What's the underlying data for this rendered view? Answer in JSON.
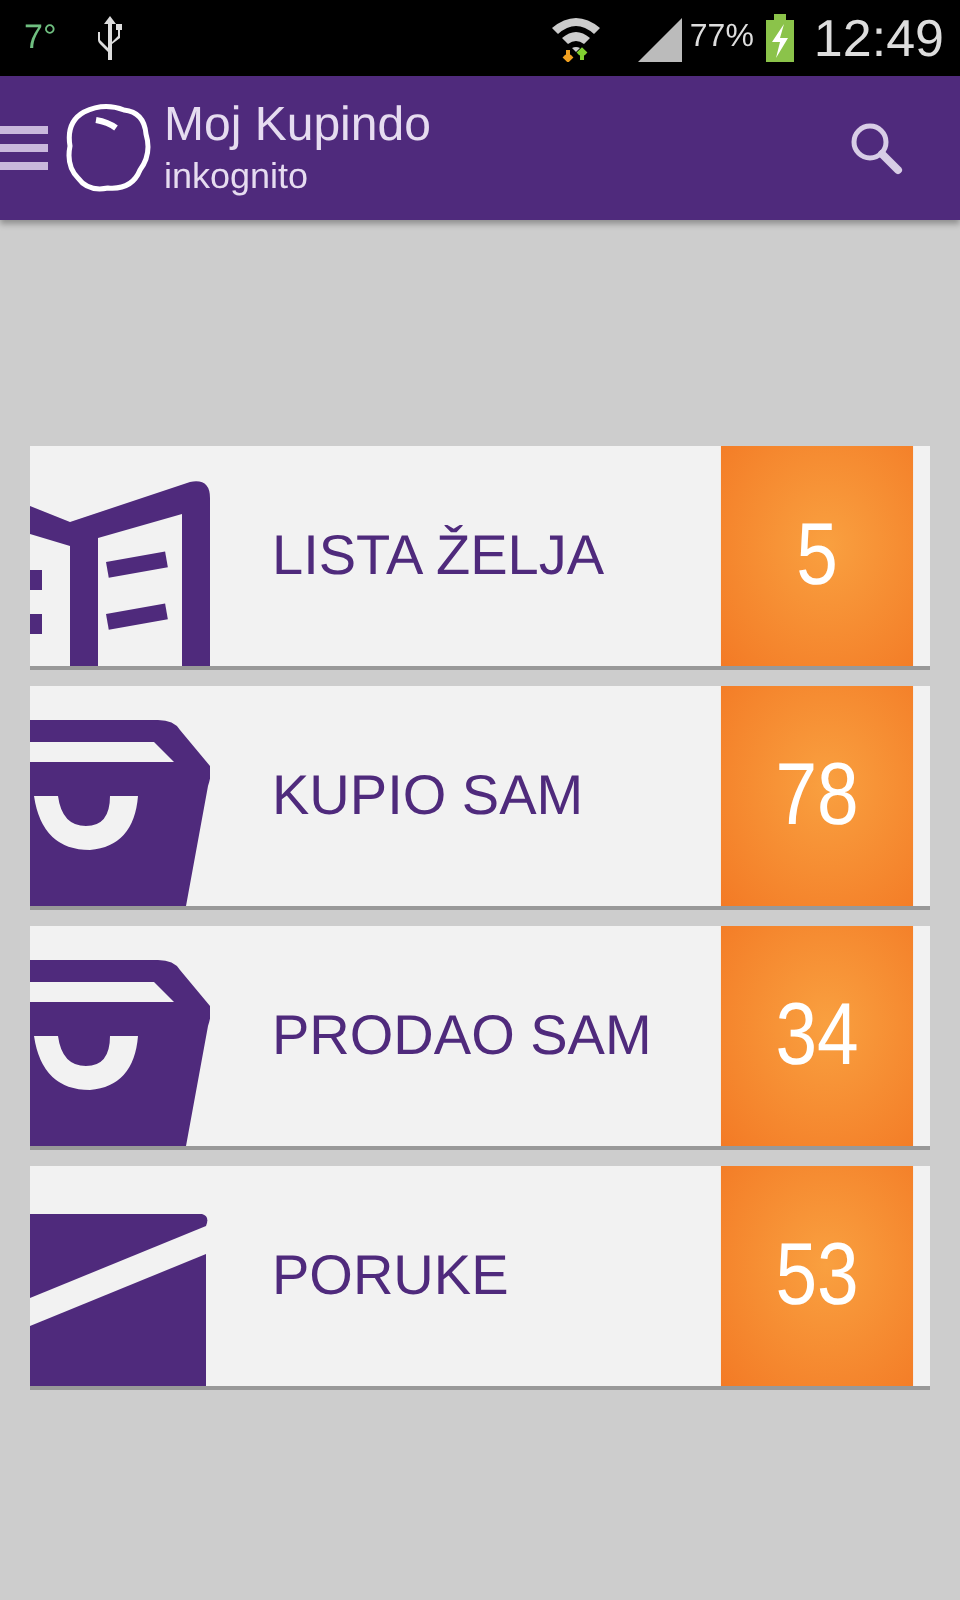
{
  "status_bar": {
    "temperature": "7°",
    "battery": "77%",
    "time": "12:49"
  },
  "app_bar": {
    "title": "Moj Kupindo",
    "subtitle": "inkognito"
  },
  "items": [
    {
      "kind": "wishlist",
      "label": "LISTA ŽELJA",
      "count": "5"
    },
    {
      "kind": "bought",
      "label": "KUPIO SAM",
      "count": "78"
    },
    {
      "kind": "sold",
      "label": "PRODAO SAM",
      "count": "34"
    },
    {
      "kind": "messages",
      "label": "PORUKE",
      "count": "53"
    }
  ]
}
